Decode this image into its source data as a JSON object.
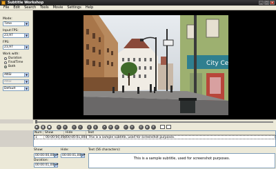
{
  "window": {
    "title": "Subtitle Workshop"
  },
  "menu": [
    "File",
    "Edit",
    "Search",
    "Tools",
    "Movie",
    "Settings",
    "Help"
  ],
  "left_panel": {
    "mode_label": "Mode:",
    "mode_value": "Time",
    "input_fps_label": "Input FPS:",
    "input_fps_value": "23,97",
    "fps_label": "FPS:",
    "fps_value": "23,97",
    "work_with_label": "Work with:",
    "work_with_options": [
      "Duration",
      "FinalTime",
      "Both"
    ],
    "work_with_selected": "Both",
    "charset1_value": "ANSI",
    "charset2_value": "ANSI",
    "format_value": "Default"
  },
  "grid": {
    "headers": [
      "Num",
      "Show",
      "Hide",
      "Text"
    ],
    "rows": [
      {
        "num": "1",
        "show": "00:00:00,000",
        "hide": "00:00:01,000",
        "text": "This is a sample subtitle, used for screenshot purposes."
      }
    ]
  },
  "editor": {
    "show_label": "Show:",
    "show_value": "00:00:00,000",
    "hide_label": "Hide:",
    "hide_value": "00:00:01,000",
    "duration_label": "Duration:",
    "duration_value": "00:00:01,000",
    "text_label": "Text (56 characters):",
    "text_value": "This is a sample subtitle, used for screenshot purposes."
  },
  "video_frame": {
    "sign_text": "City Ce"
  }
}
